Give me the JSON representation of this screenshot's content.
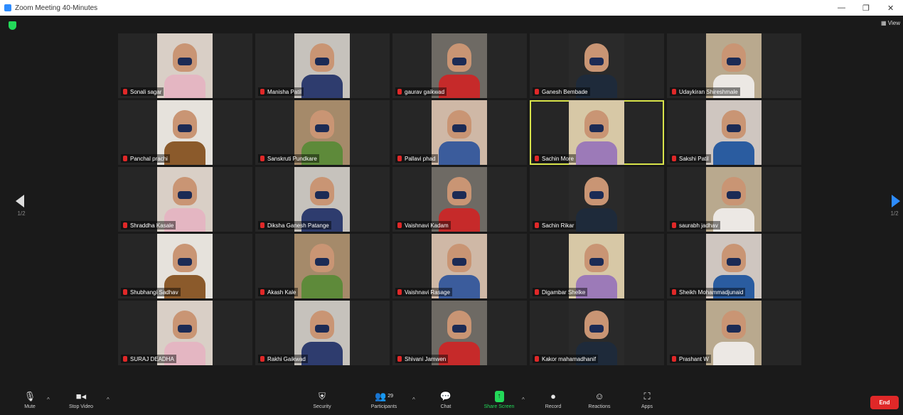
{
  "window": {
    "title": "Zoom Meeting 40-Minutes",
    "minimize": "—",
    "restore": "❐",
    "close": "✕"
  },
  "view_label": "View",
  "pages": {
    "current": "1/2",
    "next": "1/2"
  },
  "participants": [
    {
      "name": "Sonali sagar",
      "active": false
    },
    {
      "name": "Manisha Patil",
      "active": false
    },
    {
      "name": "gaurav gaikwad",
      "active": false
    },
    {
      "name": "Ganesh Bembade",
      "active": false
    },
    {
      "name": "Udaykiran Shireshmale",
      "active": false
    },
    {
      "name": "Panchal prachi",
      "active": false
    },
    {
      "name": "Sanskruti Pundkare",
      "active": false
    },
    {
      "name": "Pallavi phad",
      "active": false
    },
    {
      "name": "Sachin More",
      "active": true
    },
    {
      "name": "Sakshi Patil",
      "active": false
    },
    {
      "name": "Shraddha Kasale",
      "active": false
    },
    {
      "name": "Diksha Ganesh Patange",
      "active": false
    },
    {
      "name": "Vaishnavi Kadam",
      "active": false
    },
    {
      "name": "Sachin Rikar",
      "active": false
    },
    {
      "name": "saurabh jadhav",
      "active": false
    },
    {
      "name": "Shubhangi Sadhav",
      "active": false
    },
    {
      "name": "Akash Kale",
      "active": false
    },
    {
      "name": "Vaishnavi Rasage",
      "active": false
    },
    {
      "name": "Digambar Shelke",
      "active": false
    },
    {
      "name": "Sheikh Mohammadjunaid",
      "active": false
    },
    {
      "name": "SURAJ DEADHA",
      "active": false
    },
    {
      "name": "Rakhi Gaikwad",
      "active": false
    },
    {
      "name": "Shivani Jamwen",
      "active": false
    },
    {
      "name": "Kakor mahamadhanif",
      "active": false
    },
    {
      "name": "Prashant W",
      "active": false
    }
  ],
  "toolbar": {
    "mute": "Mute",
    "stop_video": "Stop Video",
    "security": "Security",
    "participants": "Participants",
    "participants_count": "29",
    "chat": "Chat",
    "share_screen": "Share Screen",
    "record": "Record",
    "reactions": "Reactions",
    "apps": "Apps",
    "end": "End"
  },
  "colors": {
    "active_speaker": "#d8e34a",
    "share": "#23d959",
    "end": "#e02828",
    "accent": "#2d8cff"
  }
}
